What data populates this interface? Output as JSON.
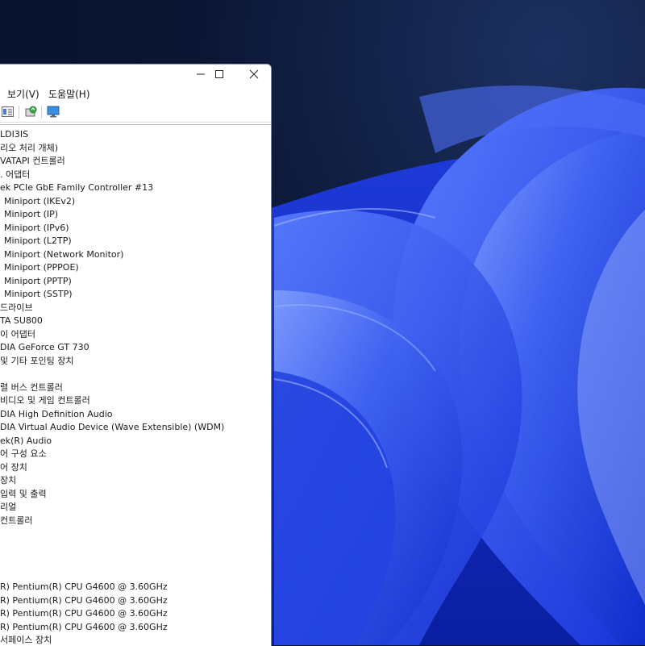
{
  "window": {
    "menu": [
      "보기(V)",
      "도움말(H)"
    ],
    "controls": [
      "minimize-icon",
      "maximize-icon",
      "close-icon"
    ],
    "toolbar_icons": [
      "properties-icon",
      "update-driver-icon",
      "monitor-icon"
    ]
  },
  "tree_rows": [
    "LDI3IS",
    "리오 처리 개체)",
    "VATAPI 컨트롤러",
    ". 어댑터",
    "ek PCIe GbE Family Controller #13",
    "Miniport (IKEv2)",
    "Miniport (IP)",
    "Miniport (IPv6)",
    "Miniport (L2TP)",
    "Miniport (Network Monitor)",
    "Miniport (PPPOE)",
    "Miniport (PPTP)",
    "Miniport (SSTP)",
    "드라이브",
    "TA SU800",
    "이 어댑터",
    "DIA GeForce GT 730",
    "및 기타 포인팅 장치",
    "",
    "렬 버스 컨트롤러",
    "비디오 및 게임 컨트롤러",
    "DIA High Definition Audio",
    "DIA Virtual Audio Device (Wave Extensible) (WDM)",
    "ek(R) Audio",
    "어 구성 요소",
    "어 장치",
    "장치",
    "입력 및 출력",
    "리얼",
    "컨트롤러",
    "",
    "",
    "",
    "",
    "R) Pentium(R) CPU G4600 @ 3.60GHz",
    "R) Pentium(R) CPU G4600 @ 3.60GHz",
    "R) Pentium(R) CPU G4600 @ 3.60GHz",
    "R) Pentium(R) CPU G4600 @ 3.60GHz",
    "서페이스 장치"
  ],
  "colors": {
    "wallpaper_dark": "#0b1634",
    "bloom_blue": "#2f56f0",
    "bloom_light": "#6f93ff"
  }
}
